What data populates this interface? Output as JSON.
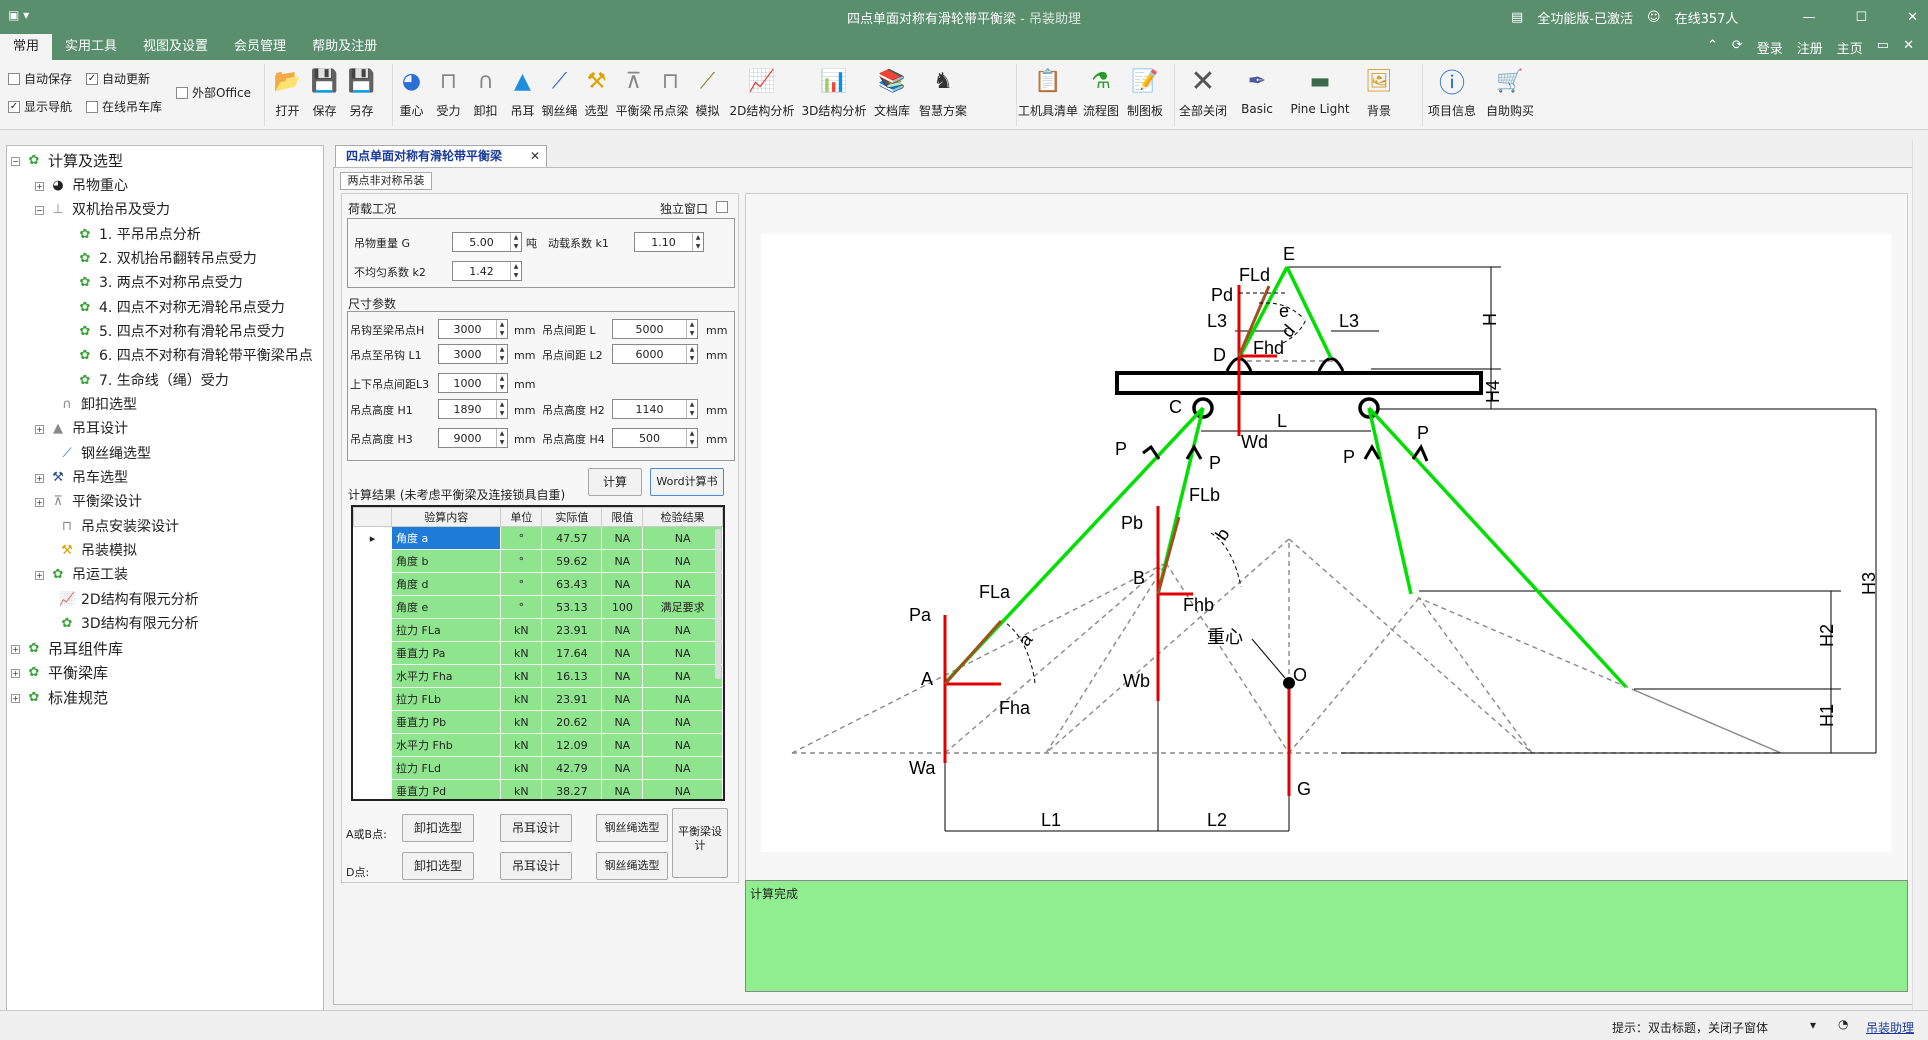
{
  "app": {
    "title": "四点单面对称有滑轮带平衡梁",
    "title_suffix": " - 吊装助理",
    "edition": "全功能版-已激活",
    "online": "在线357人"
  },
  "menu": {
    "tabs": [
      "常用",
      "实用工具",
      "视图及设置",
      "会员管理",
      "帮助及注册"
    ],
    "right": [
      "登录",
      "注册",
      "主页"
    ]
  },
  "ribbon": {
    "checks": [
      {
        "label": "自动保存",
        "checked": false
      },
      {
        "label": "自动更新",
        "checked": true
      },
      {
        "label": "外部Office",
        "checked": false
      },
      {
        "label": "显示导航",
        "checked": true
      },
      {
        "label": "在线吊车库",
        "checked": false
      }
    ],
    "file": [
      "打开",
      "保存",
      "另存"
    ],
    "tools": [
      "重心",
      "受力",
      "卸扣",
      "吊耳",
      "钢丝绳",
      "选型",
      "平衡梁",
      "吊点梁",
      "模拟",
      "2D结构分析",
      "3D结构分析",
      "文档库",
      "智慧方案"
    ],
    "misc": [
      "工机具清单",
      "流程图",
      "制图板"
    ],
    "view": [
      "全部关闭",
      "Basic",
      "Pine Light",
      "背景"
    ],
    "info": [
      "项目信息",
      "自助购买"
    ]
  },
  "tree": {
    "root": "计算及选型",
    "items": [
      "吊物重心",
      "双机抬吊及受力",
      "1. 平吊吊点分析",
      "2. 双机抬吊翻转吊点受力",
      "3. 两点不对称吊点受力",
      "4. 四点不对称无滑轮吊点受力",
      "5. 四点不对称有滑轮吊点受力",
      "6. 四点不对称有滑轮带平衡梁吊点",
      "7. 生命线（绳）受力",
      "卸扣选型",
      "吊耳设计",
      "钢丝绳选型",
      "吊车选型",
      "平衡梁设计",
      "吊点安装梁设计",
      "吊装模拟",
      "吊运工装",
      "2D结构有限元分析",
      "3D结构有限元分析"
    ],
    "roots2": [
      "吊耳组件库",
      "平衡梁库",
      "标准规范"
    ]
  },
  "doc": {
    "tab": "四点单面对称有滑轮带平衡梁",
    "subtab": "两点非对称吊装"
  },
  "form": {
    "load_title": "荷载工况",
    "independent": "独立窗口",
    "weight_label": "吊物重量 G",
    "weight": "5.00",
    "weight_unit": "吨",
    "dyn_label": "动载系数 k1",
    "dyn": "1.10",
    "uneven_label": "不均匀系数 k2",
    "uneven": "1.42",
    "size_title": "尺寸参数",
    "p1_label": "吊钩至梁吊点H",
    "p1": "3000",
    "p2_label": "吊点间距 L",
    "p2": "5000",
    "p3_label": "吊点至吊钩 L1",
    "p3": "3000",
    "p4_label": "吊点间距 L2",
    "p4": "6000",
    "p5_label": "上下吊点间距L3",
    "p5": "1000",
    "p6_label": "吊点高度 H1",
    "p6": "1890",
    "p7_label": "吊点高度 H2",
    "p7": "1140",
    "p8_label": "吊点高度 H3",
    "p8": "9000",
    "p9_label": "吊点高度 H4",
    "p9": "500",
    "unit": "mm",
    "result_title": "计算结果 (未考虑平衡梁及连接锁具自重)",
    "calc": "计算",
    "word": "Word计算书",
    "ab_label": "A或B点:",
    "d_label": "D点:",
    "b_shackle": "卸扣选型",
    "b_lug": "吊耳设计",
    "b_rope": "钢丝绳选型",
    "b_beam": "平衡梁设计"
  },
  "results": {
    "headers": [
      "验算内容",
      "单位",
      "实际值",
      "限值",
      "检验结果"
    ],
    "rows": [
      [
        "角度 a",
        "°",
        "47.57",
        "NA",
        "NA"
      ],
      [
        "角度 b",
        "°",
        "59.62",
        "NA",
        "NA"
      ],
      [
        "角度 d",
        "°",
        "63.43",
        "NA",
        "NA"
      ],
      [
        "角度 e",
        "°",
        "53.13",
        "100",
        "满足要求"
      ],
      [
        "拉力 FLa",
        "kN",
        "23.91",
        "NA",
        "NA"
      ],
      [
        "垂直力 Pa",
        "kN",
        "17.64",
        "NA",
        "NA"
      ],
      [
        "水平力 Fha",
        "kN",
        "16.13",
        "NA",
        "NA"
      ],
      [
        "拉力 FLb",
        "kN",
        "23.91",
        "NA",
        "NA"
      ],
      [
        "垂直力 Pb",
        "kN",
        "20.62",
        "NA",
        "NA"
      ],
      [
        "水平力 Fhb",
        "kN",
        "12.09",
        "NA",
        "NA"
      ],
      [
        "拉力 FLd",
        "kN",
        "42.79",
        "NA",
        "NA"
      ],
      [
        "垂直力 Pd",
        "kN",
        "38.27",
        "NA",
        "NA"
      ]
    ]
  },
  "diagram_labels": {
    "E": "E",
    "H": "H",
    "FLd": "FLd",
    "Pd": "Pd",
    "e": "e",
    "L3": "L3",
    "d": "d",
    "Fhd": "Fhd",
    "D": "D",
    "H4": "H4",
    "C": "C",
    "Wd": "Wd",
    "L": "L",
    "P": "P",
    "FLb": "FLb",
    "Pb": "Pb",
    "b": "b",
    "B": "B",
    "Fhb": "Fhb",
    "FLa": "FLa",
    "Pa": "Pa",
    "a": "a",
    "A": "A",
    "Fha": "Fha",
    "Wb": "Wb",
    "cog": "重心",
    "O": "O",
    "Wa": "Wa",
    "G": "G",
    "H1": "H1",
    "H2": "H2",
    "H3": "H3",
    "L1": "L1",
    "L2": "L2"
  },
  "output": "计算完成",
  "status": {
    "tip": "提示：双击标题，关闭子窗体",
    "help": "吊装助理"
  }
}
